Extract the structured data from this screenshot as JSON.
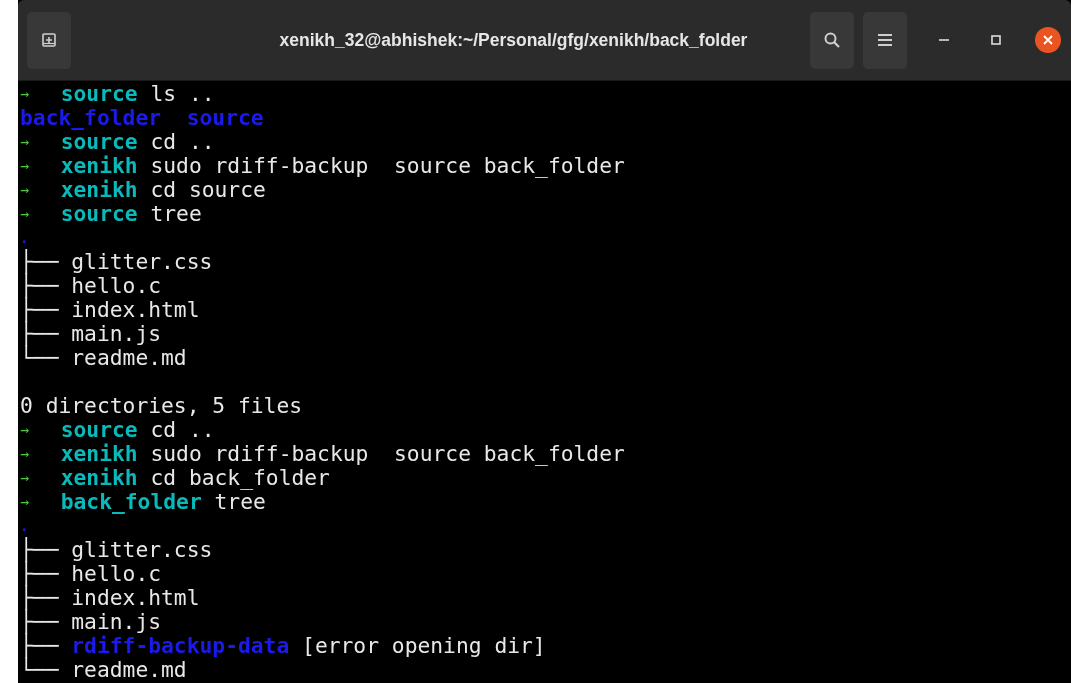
{
  "window": {
    "title": "xenikh_32@abhishek:~/Personal/gfg/xenikh/back_folder"
  },
  "terminal": {
    "lines": [
      {
        "kind": "prompt",
        "arrow": "→",
        "directory": "source",
        "command": "ls .."
      },
      {
        "kind": "listing",
        "entries": [
          "back_folder",
          "source"
        ]
      },
      {
        "kind": "prompt",
        "arrow": "→",
        "directory": "source",
        "command": "cd .."
      },
      {
        "kind": "prompt",
        "arrow": "→",
        "directory": "xenikh",
        "command": "sudo rdiff-backup  source back_folder"
      },
      {
        "kind": "prompt",
        "arrow": "→",
        "directory": "xenikh",
        "command": "cd source"
      },
      {
        "kind": "prompt",
        "arrow": "→",
        "directory": "source",
        "command": "tree"
      },
      {
        "kind": "tree-root",
        "text": "."
      },
      {
        "kind": "tree-item",
        "branch": "├──",
        "name": "glitter.css",
        "directory": false
      },
      {
        "kind": "tree-item",
        "branch": "├──",
        "name": "hello.c",
        "directory": false
      },
      {
        "kind": "tree-item",
        "branch": "├──",
        "name": "index.html",
        "directory": false
      },
      {
        "kind": "tree-item",
        "branch": "├──",
        "name": "main.js",
        "directory": false
      },
      {
        "kind": "tree-item",
        "branch": "└──",
        "name": "readme.md",
        "directory": false
      },
      {
        "kind": "blank"
      },
      {
        "kind": "text",
        "text": "0 directories, 5 files"
      },
      {
        "kind": "prompt",
        "arrow": "→",
        "directory": "source",
        "command": "cd .."
      },
      {
        "kind": "prompt",
        "arrow": "→",
        "directory": "xenikh",
        "command": "sudo rdiff-backup  source back_folder"
      },
      {
        "kind": "prompt",
        "arrow": "→",
        "directory": "xenikh",
        "command": "cd back_folder"
      },
      {
        "kind": "prompt",
        "arrow": "→",
        "directory": "back_folder",
        "command": "tree"
      },
      {
        "kind": "tree-root",
        "text": "."
      },
      {
        "kind": "tree-item",
        "branch": "├──",
        "name": "glitter.css",
        "directory": false
      },
      {
        "kind": "tree-item",
        "branch": "├──",
        "name": "hello.c",
        "directory": false
      },
      {
        "kind": "tree-item",
        "branch": "├──",
        "name": "index.html",
        "directory": false
      },
      {
        "kind": "tree-item",
        "branch": "├──",
        "name": "main.js",
        "directory": false
      },
      {
        "kind": "tree-item",
        "branch": "├──",
        "name": "rdiff-backup-data",
        "directory": true,
        "note": "[error opening dir]"
      },
      {
        "kind": "tree-item",
        "branch": "└──",
        "name": "readme.md",
        "directory": false
      }
    ]
  }
}
